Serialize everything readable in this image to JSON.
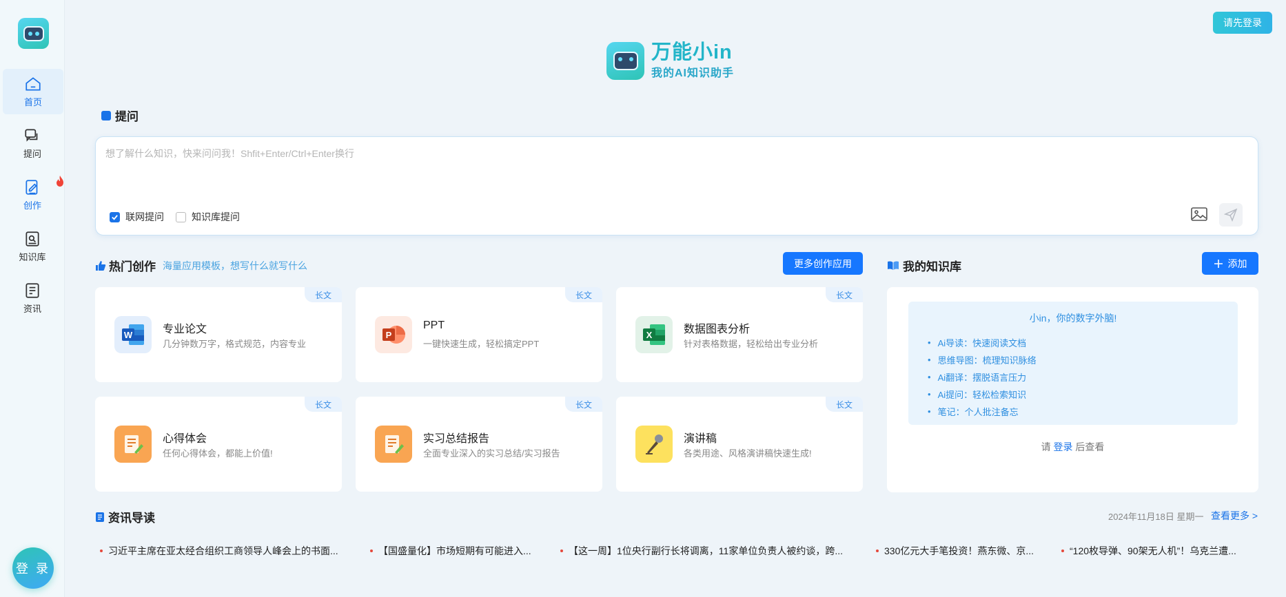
{
  "sidebar": {
    "items": [
      {
        "label": "首页",
        "icon": "home-icon"
      },
      {
        "label": "提问",
        "icon": "chat-icon"
      },
      {
        "label": "创作",
        "icon": "edit-icon"
      },
      {
        "label": "知识库",
        "icon": "knowledge-icon"
      },
      {
        "label": "资讯",
        "icon": "news-icon"
      }
    ],
    "login_label": "登 录"
  },
  "header": {
    "login_button": "请先登录",
    "brand_title": "万能小in",
    "brand_subtitle": "我的AI知识助手"
  },
  "ask": {
    "section_title": "提问",
    "placeholder": "想了解什么知识，快来问问我！Shfit+Enter/Ctrl+Enter换行",
    "option_web": "联网提问",
    "option_kb": "知识库提问",
    "web_checked": true,
    "kb_checked": false
  },
  "hot": {
    "title": "热门创作",
    "subtitle": "海量应用模板，想写什么就写什么",
    "more_button": "更多创作应用",
    "cards": [
      {
        "tag": "长文",
        "title": "专业论文",
        "desc": "几分钟数万字，格式规范，内容专业",
        "icon": "word-icon"
      },
      {
        "tag": "长文",
        "title": "PPT",
        "desc": "一键快速生成，轻松搞定PPT",
        "icon": "ppt-icon"
      },
      {
        "tag": "长文",
        "title": "数据图表分析",
        "desc": "针对表格数据，轻松给出专业分析",
        "icon": "excel-icon"
      },
      {
        "tag": "长文",
        "title": "心得体会",
        "desc": "任何心得体会，都能上价值!",
        "icon": "notes-icon"
      },
      {
        "tag": "长文",
        "title": "实习总结报告",
        "desc": "全面专业深入的实习总结/实习报告",
        "icon": "report-icon"
      },
      {
        "tag": "长文",
        "title": "演讲稿",
        "desc": "各类用途、风格演讲稿快速生成!",
        "icon": "microphone-icon"
      }
    ]
  },
  "kb": {
    "title": "我的知识库",
    "add_button": "添加",
    "headline": "小in，你的数字外脑!",
    "features": [
      "Ai导读：快速阅读文档",
      "思维导图：梳理知识脉络",
      "Ai翻译：摆脱语言压力",
      "Ai提问：轻松检索知识",
      "笔记：个人批注备忘"
    ],
    "foot_pre": "请",
    "foot_link": "登录",
    "foot_post": "后查看"
  },
  "news": {
    "title": "资讯导读",
    "date": "2024年11月18日 星期一",
    "more": "查看更多 >",
    "items": [
      "习近平主席在亚太经合组织工商领导人峰会上的书面...",
      "【国盛量化】市场短期有可能进入...",
      "【这一周】1位央行副行长将调离，11家单位负责人被约谈，跨...",
      "330亿元大手笔投资！燕东微、京...",
      "“120枚导弹、90架无人机”！乌克兰遭..."
    ]
  },
  "colors": {
    "accent": "#1677ff",
    "brand": "#23b5c9",
    "tag_bg": "#e8f2fd"
  }
}
